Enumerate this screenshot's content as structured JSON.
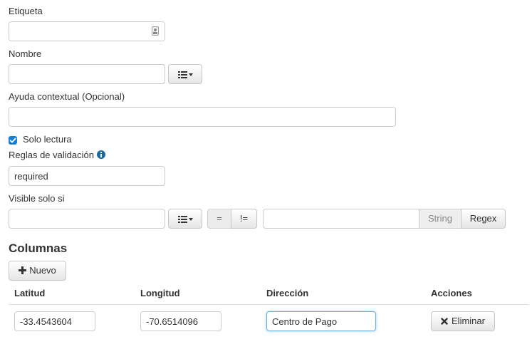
{
  "form": {
    "etiqueta_label": "Etiqueta",
    "etiqueta_value": "",
    "nombre_label": "Nombre",
    "nombre_value": "",
    "ayuda_label": "Ayuda contextual (Opcional)",
    "ayuda_value": "",
    "solo_lectura_label": "Solo lectura",
    "solo_lectura_checked": true,
    "reglas_label": "Reglas de validación",
    "reglas_value": "required",
    "visible_label": "Visible solo si",
    "visible_field_value": "",
    "visible_value": "",
    "eq_label": "=",
    "neq_label": "!=",
    "string_label": "String",
    "regex_label": "Regex"
  },
  "columnas": {
    "title": "Columnas",
    "nuevo_label": "Nuevo",
    "headers": [
      "Latitud",
      "Longitud",
      "Dirección",
      "Acciones"
    ],
    "row": {
      "latitud": "-33.4543604",
      "longitud": "-70.6514096",
      "direccion": "Centro de Pago",
      "eliminar_label": "Eliminar"
    }
  },
  "colors": {
    "checkbox": "#1a7fd4",
    "info_icon": "#1b6aa5",
    "focus_border": "#66afe9"
  },
  "icons": [
    "contact-card-icon",
    "list-icon",
    "caret-down-icon",
    "info-icon",
    "plus-icon",
    "close-x-icon",
    "checkbox-checked-icon"
  ]
}
